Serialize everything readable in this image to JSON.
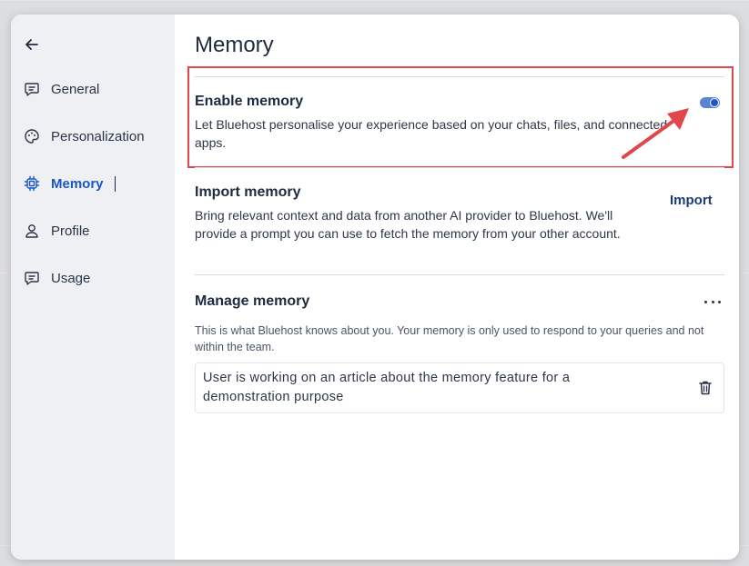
{
  "sidebar": {
    "back_icon": "arrow-left-icon",
    "items": [
      {
        "label": "General",
        "icon": "chat-icon"
      },
      {
        "label": "Personalization",
        "icon": "palette-icon"
      },
      {
        "label": "Memory",
        "icon": "chip-icon"
      },
      {
        "label": "Profile",
        "icon": "person-icon"
      },
      {
        "label": "Usage",
        "icon": "chat-icon"
      }
    ],
    "active": "Memory"
  },
  "main": {
    "title": "Memory",
    "enable_memory": {
      "title": "Enable memory",
      "description": "Let Bluehost personalise your experience based on your chats, files, and connected apps.",
      "enabled": true
    },
    "import_memory": {
      "title": "Import memory",
      "description": "Bring relevant context and data from another AI provider to Bluehost. We'll provide a prompt you can use to fetch the memory from your other account.",
      "button_label": "Import"
    },
    "manage_memory": {
      "title": "Manage memory",
      "description": "This is what Bluehost knows about you. Your memory is only used to respond to your queries and not within the team.",
      "memories": [
        {
          "text": "User is working on an article about the memory feature for a demonstration purpose"
        }
      ]
    }
  },
  "colors": {
    "accent": "#1b56c9",
    "highlight": "#e0464a"
  }
}
